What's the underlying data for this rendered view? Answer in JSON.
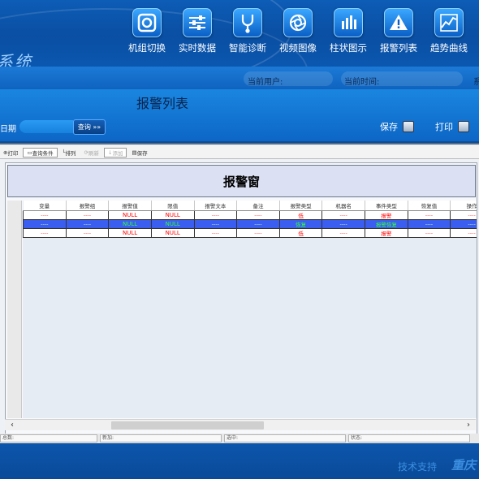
{
  "header": {
    "system_title": "系统",
    "nav": [
      {
        "icon": "unit-switch-icon",
        "label": "机组切换"
      },
      {
        "icon": "realtime-data-icon",
        "label": "实时数据"
      },
      {
        "icon": "diagnosis-icon",
        "label": "智能诊断"
      },
      {
        "icon": "video-icon",
        "label": "视频图像"
      },
      {
        "icon": "bar-chart-icon",
        "label": "柱状图示"
      },
      {
        "icon": "alarm-list-icon",
        "label": "报警列表"
      },
      {
        "icon": "trend-curve-icon",
        "label": "趋势曲线"
      }
    ]
  },
  "infobar": {
    "current_user_label": "当前用户:",
    "current_time_label": "当前时间:",
    "right_label": "系"
  },
  "page": {
    "title": "报警列表",
    "date_label": "日期",
    "query_label": "查询 »»",
    "save_label": "保存",
    "print_label": "打印"
  },
  "toolbar": {
    "items": [
      "打印",
      "查询条件",
      "排列",
      "刷新",
      "添加",
      "保存"
    ]
  },
  "grid": {
    "window_title": "报警窗",
    "columns": [
      "变量",
      "报警组",
      "报警值",
      "限值",
      "报警文本",
      "备注",
      "报警类型",
      "机器名",
      "事件类型",
      "恢复值",
      "操作"
    ],
    "rows": [
      {
        "cells": [
          "----",
          "----",
          "NULL",
          "NULL",
          "----",
          "----",
          "低",
          "----",
          "报警",
          "----",
          "----"
        ],
        "selected": false
      },
      {
        "cells": [
          "----",
          "----",
          "NULL",
          "NULL",
          "----",
          "----",
          "恢复",
          "----",
          "报警恢复",
          "----",
          "----"
        ],
        "selected": true
      },
      {
        "cells": [
          "----",
          "----",
          "NULL",
          "NULL",
          "----",
          "----",
          "低",
          "----",
          "报警",
          "----",
          "----"
        ],
        "selected": false
      }
    ]
  },
  "statusbar": {
    "cells": [
      "总数:",
      "新加:",
      "选中:",
      "状态:"
    ]
  },
  "footer": {
    "support_label": "技术支持",
    "brand": "重庆"
  },
  "colors": {
    "header_blue": "#0d5cb6",
    "selected_row": "#3b5ef0",
    "alarm_red": "#ff0000",
    "recovery_green": "#33ff33"
  }
}
